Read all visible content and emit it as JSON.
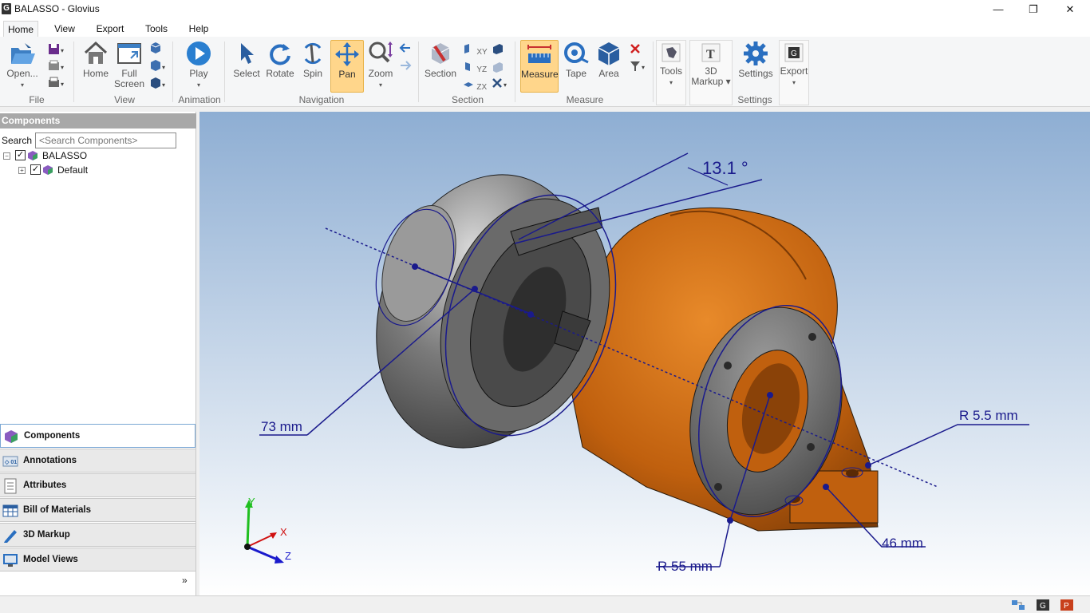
{
  "window": {
    "title": "BALASSO - Glovius",
    "minimize": "—",
    "restore": "❐",
    "close": "✕"
  },
  "menu": [
    {
      "label": "Home",
      "active": true
    },
    {
      "label": "View"
    },
    {
      "label": "Export"
    },
    {
      "label": "Tools"
    },
    {
      "label": "Help"
    }
  ],
  "ribbon": {
    "file": {
      "group": "File",
      "open": "Open..."
    },
    "view": {
      "group": "View",
      "home": "Home",
      "full_screen_1": "Full",
      "full_screen_2": "Screen"
    },
    "animation": {
      "group": "Animation",
      "play": "Play"
    },
    "navigation": {
      "group": "Navigation",
      "select": "Select",
      "rotate": "Rotate",
      "spin": "Spin",
      "pan": "Pan",
      "zoom": "Zoom"
    },
    "section": {
      "group": "Section",
      "section": "Section",
      "xy": "XY",
      "yz": "YZ",
      "zx": "ZX"
    },
    "measure": {
      "group": "Measure",
      "measure": "Measure",
      "tape": "Tape",
      "area": "Area"
    },
    "tools": {
      "tools": "Tools",
      "markup_1": "3D",
      "markup_2": "Markup"
    },
    "settings": {
      "group": "Settings",
      "settings": "Settings"
    },
    "export": {
      "export": "Export"
    }
  },
  "panel": {
    "title": "Components",
    "search_label": "Search :",
    "search_placeholder": "<Search Components>",
    "tree": [
      {
        "label": "BALASSO",
        "toggle": "−"
      },
      {
        "label": "Default",
        "toggle": "+"
      }
    ],
    "check": "✓",
    "nav": [
      {
        "label": "Components",
        "icon": "components-icon",
        "active": true
      },
      {
        "label": "Annotations",
        "icon": "annotations-icon"
      },
      {
        "label": "Attributes",
        "icon": "attributes-icon"
      },
      {
        "label": "Bill of Materials",
        "icon": "bom-icon"
      },
      {
        "label": "3D Markup",
        "icon": "markup-icon"
      },
      {
        "label": "Model Views",
        "icon": "model-views-icon"
      }
    ],
    "more": "»"
  },
  "viewport": {
    "angle_label": "13.1 °",
    "dim_73": "73 mm",
    "dim_r55": "R 55 mm",
    "dim_r55_small": "R 5.5 mm",
    "dim_46": "46 mm",
    "axis_x": "X",
    "axis_y": "Y",
    "axis_z": "Z",
    "colors": {
      "bg_top": "#8eaed3",
      "bg_bottom": "#ffffff",
      "dimension": "#1a1a8c",
      "compressor": "#6b6b6b",
      "turbine": "#c9650f"
    }
  }
}
